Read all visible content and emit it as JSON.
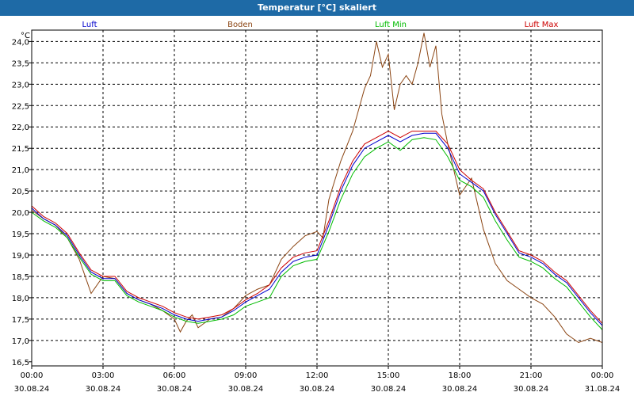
{
  "window": {
    "title": "Temperatur [°C] skaliert"
  },
  "chart_data": {
    "type": "line",
    "title": "Temperatur [°C] skaliert",
    "ylabel": "°C",
    "ylim": [
      16.5,
      24.4
    ],
    "yticks": [
      "24,0",
      "23,5",
      "23,0",
      "22,5",
      "22,0",
      "21,5",
      "21,0",
      "20,5",
      "20,0",
      "19,5",
      "19,0",
      "18,5",
      "18,0",
      "17,5",
      "17,0",
      "16,5"
    ],
    "xlim": [
      0,
      24
    ],
    "xtick_times": [
      "00:00",
      "03:00",
      "06:00",
      "09:00",
      "12:00",
      "15:00",
      "18:00",
      "21:00",
      "00:00"
    ],
    "xtick_dates": [
      "30.08.24",
      "30.08.24",
      "30.08.24",
      "30.08.24",
      "30.08.24",
      "30.08.24",
      "30.08.24",
      "30.08.24",
      "31.08.24"
    ],
    "grid": true,
    "legend_position": "top",
    "series": [
      {
        "name": "Luft",
        "color": "#0000cc",
        "x": [
          0,
          0.5,
          1,
          1.5,
          2,
          2.5,
          3,
          3.5,
          4,
          4.5,
          5,
          5.5,
          6,
          6.5,
          7,
          7.5,
          8,
          8.5,
          9,
          9.5,
          10,
          10.5,
          11,
          11.5,
          12,
          12.5,
          13,
          13.5,
          14,
          14.5,
          15,
          15.5,
          16,
          16.5,
          17,
          17.5,
          18,
          18.5,
          19,
          19.5,
          20,
          20.5,
          21,
          21.5,
          22,
          22.5,
          23,
          23.5,
          24
        ],
        "values": [
          20.1,
          19.85,
          19.7,
          19.45,
          19.0,
          18.6,
          18.45,
          18.45,
          18.1,
          17.95,
          17.85,
          17.75,
          17.6,
          17.5,
          17.45,
          17.5,
          17.55,
          17.7,
          17.9,
          18.05,
          18.2,
          18.6,
          18.85,
          18.95,
          19.0,
          19.7,
          20.5,
          21.1,
          21.5,
          21.65,
          21.8,
          21.65,
          21.8,
          21.85,
          21.85,
          21.5,
          20.9,
          20.7,
          20.5,
          19.95,
          19.5,
          19.05,
          18.95,
          18.8,
          18.55,
          18.35,
          18.0,
          17.65,
          17.35
        ]
      },
      {
        "name": "Boden",
        "color": "#8b4513",
        "x": [
          0,
          0.5,
          1,
          1.5,
          2,
          2.5,
          3,
          3.5,
          4,
          4.5,
          5,
          5.5,
          6,
          6.25,
          6.5,
          6.75,
          7,
          7.5,
          8,
          8.5,
          9,
          9.5,
          10,
          10.5,
          11,
          11.5,
          12,
          12.25,
          12.5,
          13,
          13.5,
          14,
          14.25,
          14.5,
          14.75,
          15,
          15.25,
          15.5,
          15.75,
          16,
          16.25,
          16.5,
          16.75,
          17,
          17.25,
          17.5,
          18,
          18.5,
          19,
          19.5,
          20,
          20.5,
          21,
          21.5,
          22,
          22.5,
          23,
          23.5,
          24
        ],
        "values": [
          20.05,
          19.85,
          19.7,
          19.4,
          18.9,
          18.1,
          18.5,
          18.45,
          18.1,
          17.95,
          17.85,
          17.7,
          17.5,
          17.2,
          17.45,
          17.6,
          17.3,
          17.5,
          17.55,
          17.75,
          18.05,
          18.2,
          18.3,
          18.9,
          19.2,
          19.45,
          19.55,
          19.4,
          20.3,
          21.2,
          21.9,
          22.9,
          23.2,
          24.0,
          23.4,
          23.7,
          22.4,
          23.0,
          23.2,
          23.0,
          23.5,
          24.2,
          23.4,
          23.9,
          22.3,
          21.6,
          20.4,
          20.8,
          19.6,
          18.8,
          18.4,
          18.2,
          18.0,
          17.85,
          17.55,
          17.15,
          16.95,
          17.05,
          16.95
        ]
      },
      {
        "name": "Luft Min",
        "color": "#00bb00",
        "x": [
          0,
          0.5,
          1,
          1.5,
          2,
          2.5,
          3,
          3.5,
          4,
          4.5,
          5,
          5.5,
          6,
          6.5,
          7,
          7.5,
          8,
          8.5,
          9,
          9.5,
          10,
          10.5,
          11,
          11.5,
          12,
          12.5,
          13,
          13.5,
          14,
          14.5,
          15,
          15.5,
          16,
          16.5,
          17,
          17.5,
          18,
          18.5,
          19,
          19.5,
          20,
          20.5,
          21,
          21.5,
          22,
          22.5,
          23,
          23.5,
          24
        ],
        "values": [
          20.0,
          19.8,
          19.65,
          19.4,
          18.95,
          18.55,
          18.4,
          18.4,
          18.05,
          17.9,
          17.8,
          17.7,
          17.55,
          17.45,
          17.4,
          17.45,
          17.5,
          17.6,
          17.8,
          17.9,
          18.0,
          18.5,
          18.75,
          18.85,
          18.9,
          19.55,
          20.3,
          20.9,
          21.3,
          21.5,
          21.65,
          21.45,
          21.7,
          21.75,
          21.7,
          21.3,
          20.75,
          20.6,
          20.35,
          19.8,
          19.35,
          18.95,
          18.85,
          18.7,
          18.45,
          18.25,
          17.9,
          17.55,
          17.25
        ]
      },
      {
        "name": "Luft Max",
        "color": "#cc0000",
        "x": [
          0,
          0.5,
          1,
          1.5,
          2,
          2.5,
          3,
          3.5,
          4,
          4.5,
          5,
          5.5,
          6,
          6.5,
          7,
          7.5,
          8,
          8.5,
          9,
          9.5,
          10,
          10.5,
          11,
          11.5,
          12,
          12.5,
          13,
          13.5,
          14,
          14.5,
          15,
          15.5,
          16,
          16.5,
          17,
          17.5,
          18,
          18.5,
          19,
          19.5,
          20,
          20.5,
          21,
          21.5,
          22,
          22.5,
          23,
          23.5,
          24
        ],
        "values": [
          20.15,
          19.9,
          19.75,
          19.5,
          19.05,
          18.65,
          18.5,
          18.5,
          18.15,
          18.0,
          17.9,
          17.8,
          17.65,
          17.55,
          17.5,
          17.55,
          17.6,
          17.75,
          17.95,
          18.1,
          18.3,
          18.7,
          18.95,
          19.05,
          19.1,
          19.8,
          20.6,
          21.2,
          21.6,
          21.75,
          21.9,
          21.75,
          21.9,
          21.9,
          21.9,
          21.6,
          21.0,
          20.75,
          20.55,
          20.0,
          19.55,
          19.1,
          19.0,
          18.85,
          18.6,
          18.4,
          18.05,
          17.7,
          17.4
        ]
      }
    ]
  }
}
